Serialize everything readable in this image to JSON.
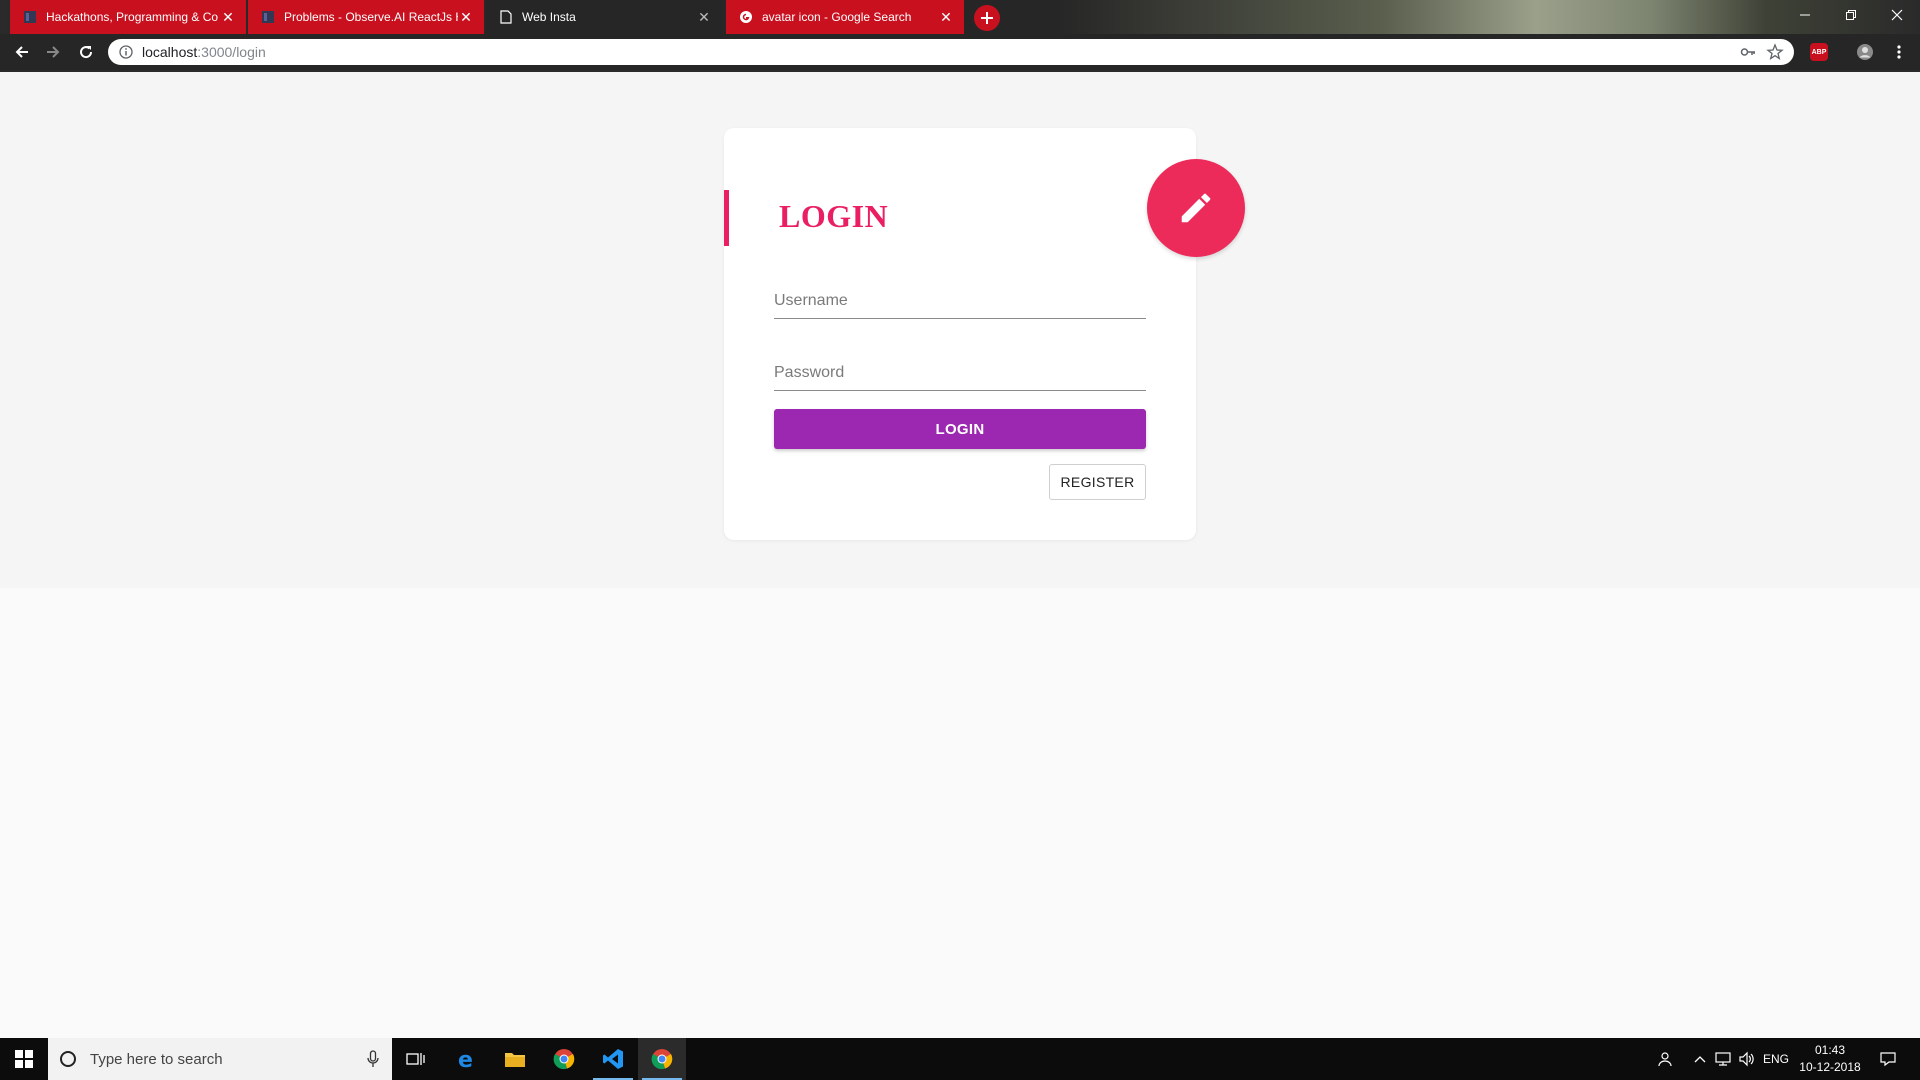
{
  "browser": {
    "tabs": [
      {
        "title": "Hackathons, Programming & Co",
        "favicon": "hackerearth-icon",
        "state": "inactive"
      },
      {
        "title": "Problems - Observe.AI ReactJs H",
        "favicon": "hackerearth-icon",
        "state": "inactive"
      },
      {
        "title": "Web Insta",
        "favicon": "page-icon",
        "state": "active"
      },
      {
        "title": "avatar icon - Google Search",
        "favicon": "google-icon",
        "state": "inactive"
      }
    ],
    "url_host": "localhost",
    "url_rest": ":3000/login",
    "abp_badge": "ABP"
  },
  "login_card": {
    "title": "LOGIN",
    "username_placeholder": "Username",
    "password_placeholder": "Password",
    "login_label": "LOGIN",
    "register_label": "REGISTER",
    "accent_color": "#e91e63",
    "button_color": "#9c27b0",
    "fab_icon": "pencil-icon"
  },
  "taskbar": {
    "search_placeholder": "Type here to search",
    "language": "ENG",
    "time": "01:43",
    "date": "10-12-2018"
  }
}
